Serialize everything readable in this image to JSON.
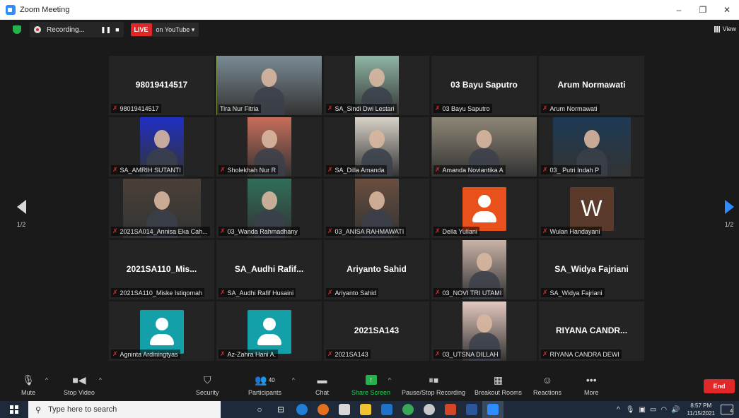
{
  "window": {
    "title": "Zoom Meeting",
    "minimize_glyph": "–",
    "restore_glyph": "❐",
    "close_glyph": "✕"
  },
  "topbar": {
    "recording_text": "Recording...",
    "pause_glyph": "❚❚",
    "stop_glyph": "■",
    "live_label": "LIVE",
    "live_dest": "on YouTube ▾",
    "view_label": "View"
  },
  "navigation": {
    "left_page": "1/2",
    "right_page": "1/2"
  },
  "colors": {
    "live_red": "#e02828",
    "speaker_highlight": "#b9e94b",
    "share_green": "#24b24b",
    "zoom_blue": "#2d8cff",
    "avatar_teal": "#13a0a8",
    "avatar_orange": "#e8501c",
    "avatar_brown": "#5a3a2a"
  },
  "tiles": [
    {
      "label": "98019414517",
      "big_name": "98019414517",
      "kind": "name",
      "muted": true
    },
    {
      "label": "Tira Nur Fitria",
      "kind": "video",
      "muted": false,
      "active": true,
      "bg": "#7a8b94"
    },
    {
      "label": "SA_Sindi Dwi Lestari",
      "kind": "video",
      "muted": true,
      "bg": "#8fb6a4",
      "w": 62
    },
    {
      "label": "03 Bayu Saputro",
      "big_name": "03 Bayu Saputro",
      "kind": "name",
      "muted": true
    },
    {
      "label": "Arum Normawati",
      "big_name": "Arum Normawati",
      "kind": "name",
      "muted": true
    },
    {
      "label": "SA_AMRIH SUTANTI",
      "kind": "video",
      "muted": true,
      "bg": "#1f2fc4",
      "w": 62
    },
    {
      "label": "Sholekhah Nur R",
      "kind": "video",
      "muted": true,
      "bg": "#c86e5a",
      "w": 62
    },
    {
      "label": "SA_Dilla Amanda",
      "kind": "video",
      "muted": true,
      "bg": "#d8d2c8",
      "w": 62
    },
    {
      "label": "Amanda Noviantika A",
      "kind": "video",
      "muted": true,
      "bg": "#8e8676",
      "w": 149
    },
    {
      "label": "03_ Putri Indah P",
      "kind": "video",
      "muted": true,
      "bg": "#1d3a55",
      "w": 110
    },
    {
      "label": "2021SA014_Annisa Eka Cah...",
      "kind": "video",
      "muted": true,
      "bg": "#4a4038",
      "w": 110
    },
    {
      "label": "03_Wanda Rahmadhany",
      "kind": "video",
      "muted": true,
      "bg": "#2f6f5a",
      "w": 62
    },
    {
      "label": "03_ANISA RAHMAWATI",
      "kind": "video",
      "muted": true,
      "bg": "#6a4e3e",
      "w": 62
    },
    {
      "label": "Della Yuliani",
      "kind": "avatar",
      "muted": true,
      "avatar_color": "#e8501c"
    },
    {
      "label": "Wulan Handayani",
      "kind": "letter",
      "muted": true,
      "letter": "W",
      "avatar_color": "#5a3a2a"
    },
    {
      "label": "2021SA110_Miske Istiqomah",
      "big_name": "2021SA110_Mis...",
      "kind": "name",
      "muted": true
    },
    {
      "label": "SA_Audhi Rafif Husaini",
      "big_name": "SA_Audhi Rafif...",
      "kind": "name",
      "muted": true
    },
    {
      "label": "Ariyanto Sahid",
      "big_name": "Ariyanto Sahid",
      "kind": "name",
      "muted": true
    },
    {
      "label": "03_NOVI TRI UTAMI",
      "kind": "video",
      "muted": true,
      "bg": "#c9b3a8",
      "w": 62
    },
    {
      "label": "SA_Widya Fajriani",
      "big_name": "SA_Widya Fajriani",
      "kind": "name",
      "muted": true
    },
    {
      "label": "Agninta Ardiningtyas",
      "kind": "avatar",
      "muted": true,
      "avatar_color": "#13a0a8"
    },
    {
      "label": "Az-Zahra Hani A.",
      "kind": "avatar",
      "muted": true,
      "avatar_color": "#13a0a8"
    },
    {
      "label": "2021SA143",
      "big_name": "2021SA143",
      "kind": "name",
      "muted": true
    },
    {
      "label": "03_UTSNA DILLAH",
      "kind": "video",
      "muted": true,
      "bg": "#e4c9c0",
      "w": 62
    },
    {
      "label": "RIYANA CANDRA DEWI",
      "big_name": "RIYANA CANDR...",
      "kind": "name",
      "muted": true
    }
  ],
  "toolbar": {
    "mute": {
      "label": "Mute",
      "icon": "microphone-icon"
    },
    "stop_video": {
      "label": "Stop Video",
      "icon": "video-camera-icon"
    },
    "security": {
      "label": "Security",
      "icon": "shield-icon"
    },
    "participants": {
      "label": "Participants",
      "count": "40",
      "icon": "people-icon"
    },
    "chat": {
      "label": "Chat",
      "icon": "chat-bubble-icon"
    },
    "share_screen": {
      "label": "Share Screen",
      "icon": "share-arrow-icon"
    },
    "pause_stop_recording": {
      "label": "Pause/Stop Recording",
      "icon": "pause-stop-icon"
    },
    "breakout_rooms": {
      "label": "Breakout Rooms",
      "icon": "grid-icon"
    },
    "reactions": {
      "label": "Reactions",
      "icon": "smile-icon"
    },
    "more": {
      "label": "More",
      "icon": "ellipsis-icon"
    },
    "end": {
      "label": "End"
    }
  },
  "taskbar": {
    "search_placeholder": "Type here to search",
    "time": "8:57 PM",
    "date": "11/15/2021",
    "notification_count": "4"
  }
}
